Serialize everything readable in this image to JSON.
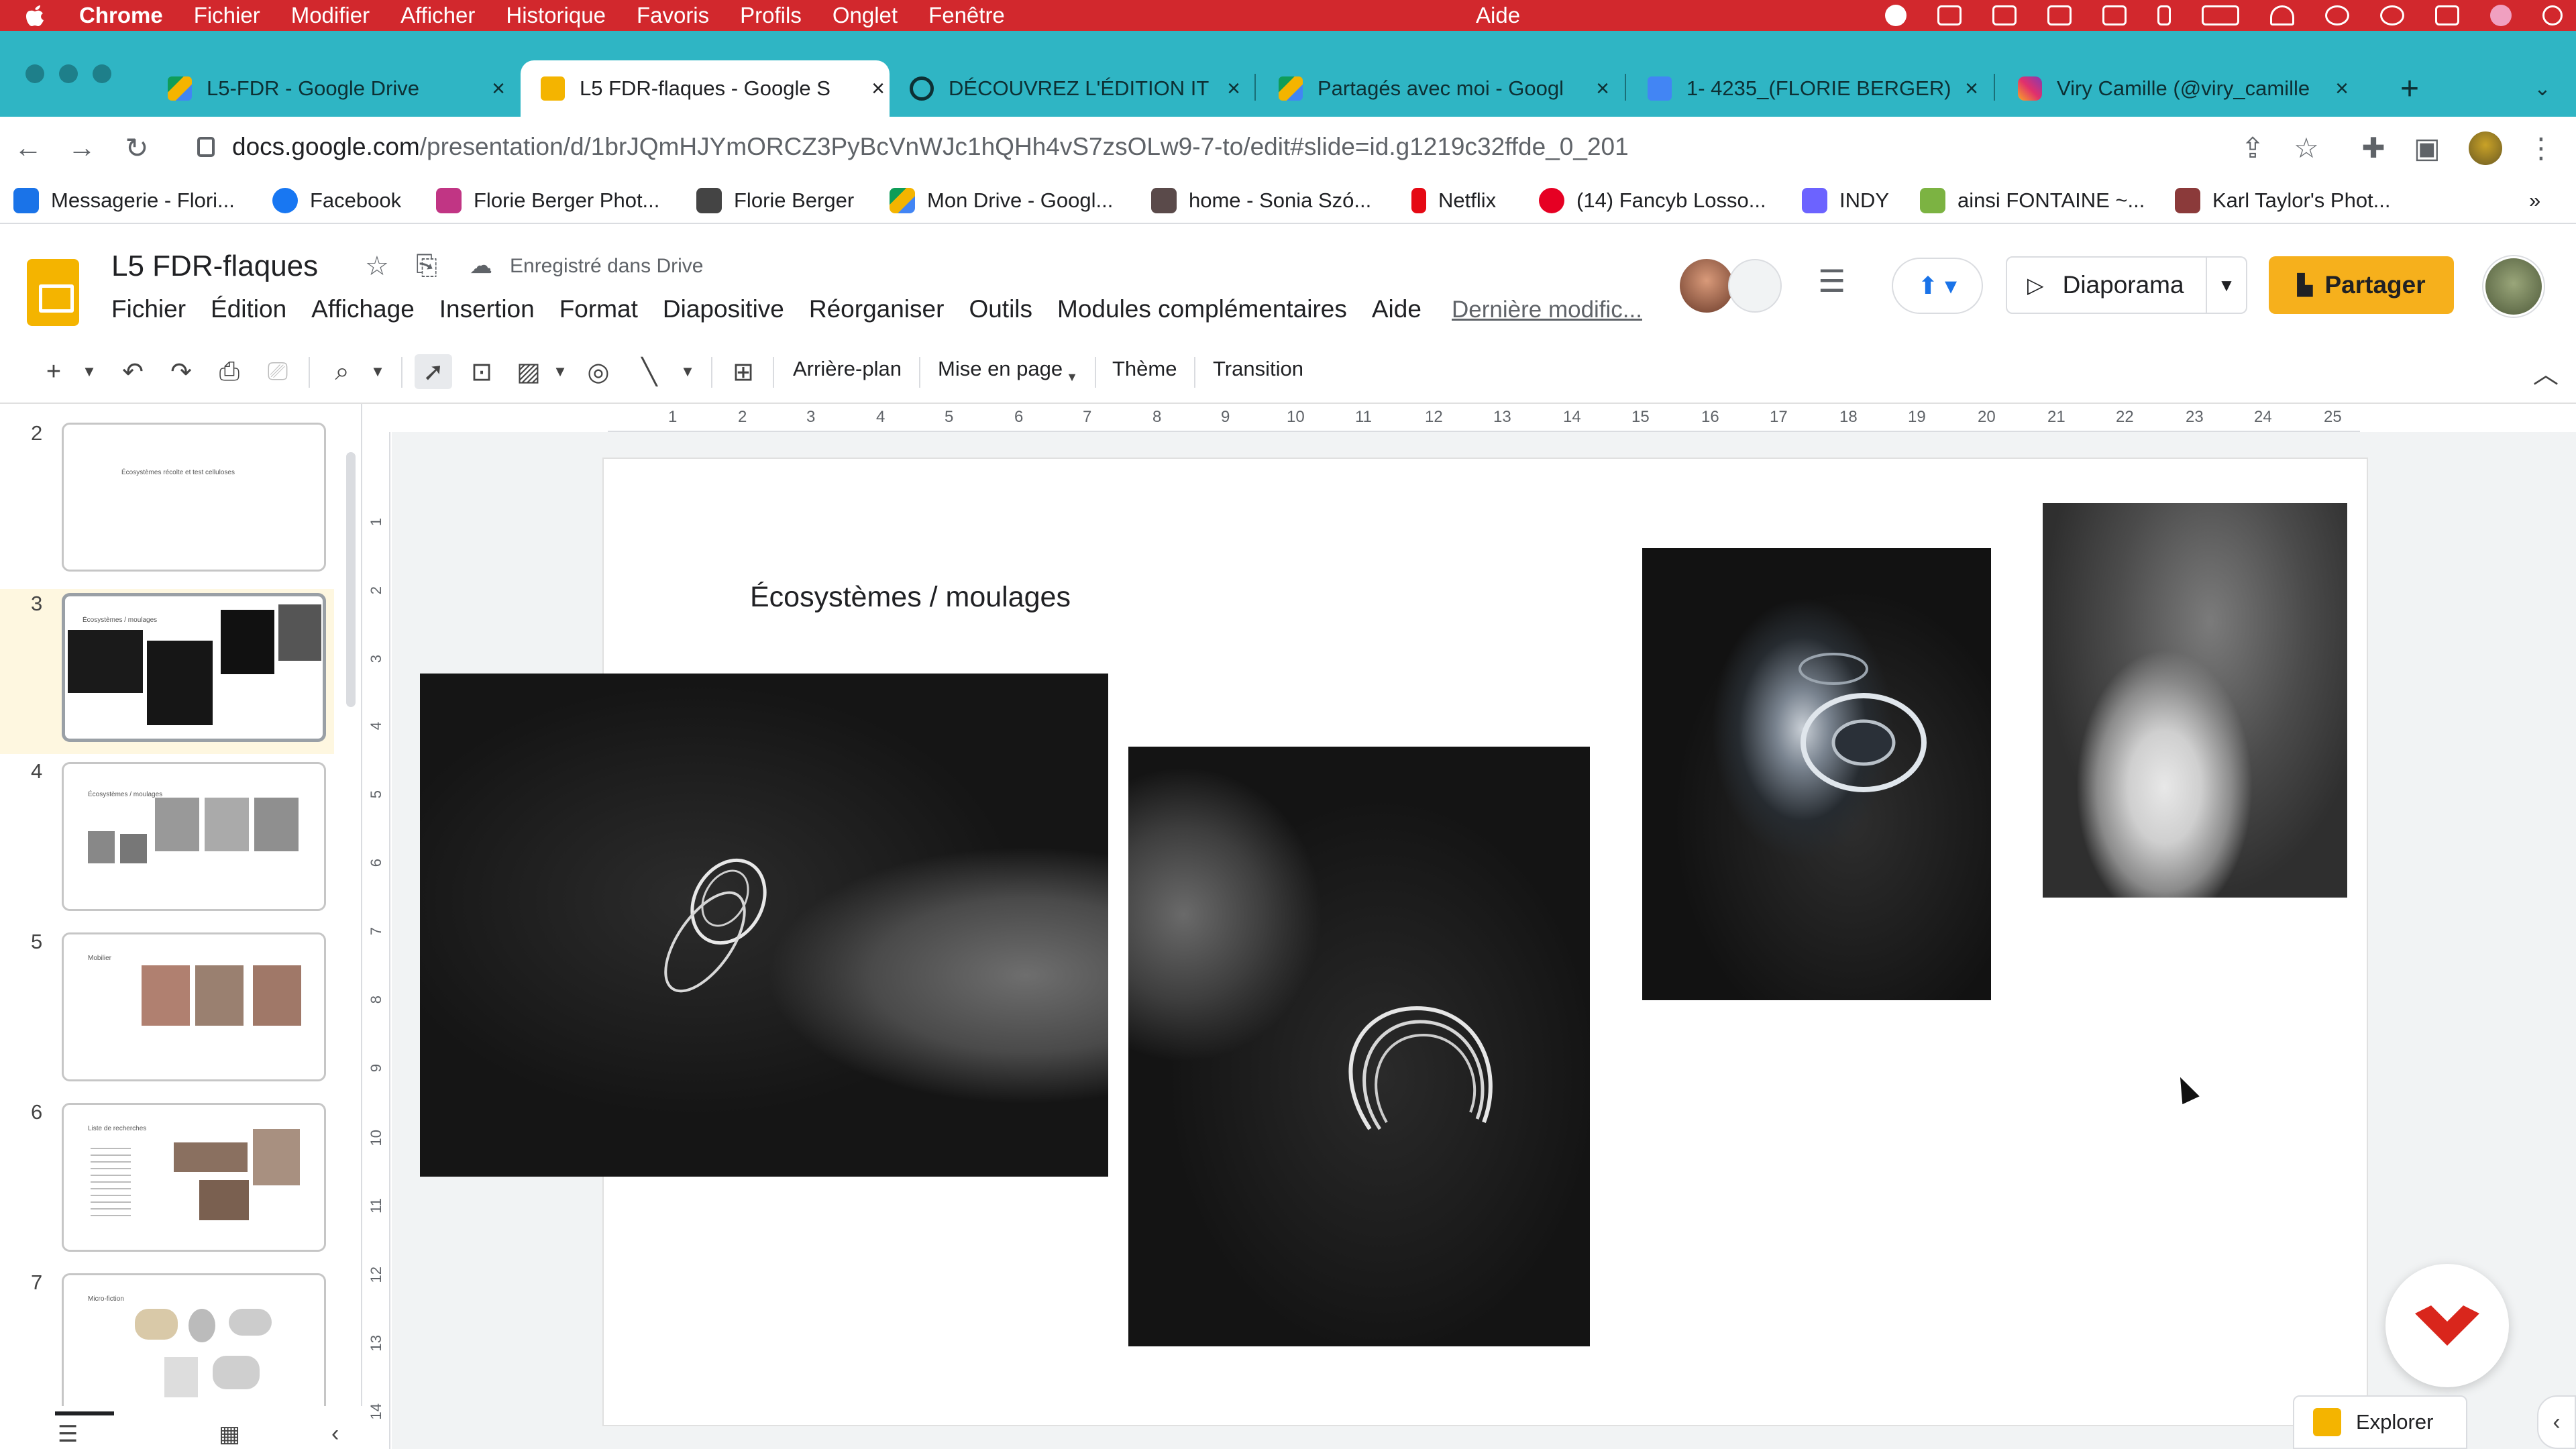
{
  "menubar": {
    "app": "Chrome",
    "items": [
      "Fichier",
      "Modifier",
      "Afficher",
      "Historique",
      "Favoris",
      "Profils",
      "Onglet",
      "Fenêtre"
    ],
    "center": "Aide"
  },
  "tabs": [
    {
      "title": "L5-FDR - Google Drive",
      "icon": "google-drive-icon"
    },
    {
      "title": "L5 FDR-flaques - Google S",
      "icon": "google-slides-icon"
    },
    {
      "title": "DÉCOUVREZ L'ÉDITION IT",
      "icon": "circle-logo-icon"
    },
    {
      "title": "Partagés avec moi - Googl",
      "icon": "google-drive-icon"
    },
    {
      "title": "1- 4235_(FLORIE BERGER)",
      "icon": "google-docs-icon"
    },
    {
      "title": "Viry Camille (@viry_camille",
      "icon": "instagram-icon"
    }
  ],
  "url": {
    "host": "docs.google.com",
    "path": "/presentation/d/1brJQmHJYmORCZ3PyBcVnWJc1hQHh4vS7zsOLw9-7-to/edit#slide=id.g1219c32ffde_0_201"
  },
  "bookmarks": [
    {
      "label": "Messagerie - Flori...",
      "color": "#1a73e8"
    },
    {
      "label": "Facebook",
      "color": "#1877f2"
    },
    {
      "label": "Florie Berger Phot...",
      "color": "#c13584"
    },
    {
      "label": "Florie Berger",
      "color": "#444444"
    },
    {
      "label": "Mon Drive - Googl...",
      "color": "#34a853"
    },
    {
      "label": "home - Sonia Szó...",
      "color": "#5a4a4a"
    },
    {
      "label": "Netflix",
      "color": "#e50914"
    },
    {
      "label": "(14) Fancyb Losso...",
      "color": "#e60023"
    },
    {
      "label": "INDY",
      "color": "#6c63ff"
    },
    {
      "label": "ainsi FONTAINE ~...",
      "color": "#7cb342"
    },
    {
      "label": "Karl Taylor's Phot...",
      "color": "#8b3a3a"
    }
  ],
  "doc": {
    "title": "L5 FDR-flaques",
    "saved": "Enregistré dans Drive",
    "menus": [
      "Fichier",
      "Édition",
      "Affichage",
      "Insertion",
      "Format",
      "Diapositive",
      "Réorganiser",
      "Outils",
      "Modules complémentaires",
      "Aide"
    ],
    "last_modified": "Dernière modific...",
    "present_label": "Diaporama",
    "share_label": "Partager"
  },
  "toolbar": {
    "background": "Arrière-plan",
    "layout": "Mise en page",
    "theme": "Thème",
    "transition": "Transition"
  },
  "filmstrip": {
    "numbers": [
      "2",
      "3",
      "4",
      "5",
      "6",
      "7"
    ],
    "selected": "3",
    "thumb_texts": {
      "s2": "Écosystèmes récolte et test celluloses",
      "s3": "Écosystèmes / moulages",
      "s4": "Écosystèmes / moulages",
      "s5": "Mobilier",
      "s6": "Liste de recherches",
      "s7": "Micro-fiction"
    }
  },
  "ruler": {
    "h": [
      "1",
      "2",
      "3",
      "4",
      "5",
      "6",
      "7",
      "8",
      "9",
      "10",
      "11",
      "12",
      "13",
      "14",
      "15",
      "16",
      "17",
      "18",
      "19",
      "20",
      "21",
      "22",
      "23",
      "24",
      "25"
    ],
    "v": [
      "1",
      "2",
      "3",
      "4",
      "5",
      "6",
      "7",
      "8",
      "9",
      "10",
      "11",
      "12",
      "13",
      "14"
    ]
  },
  "slide": {
    "title": "Écosystèmes / moulages"
  },
  "explore_label": "Explore r"
}
